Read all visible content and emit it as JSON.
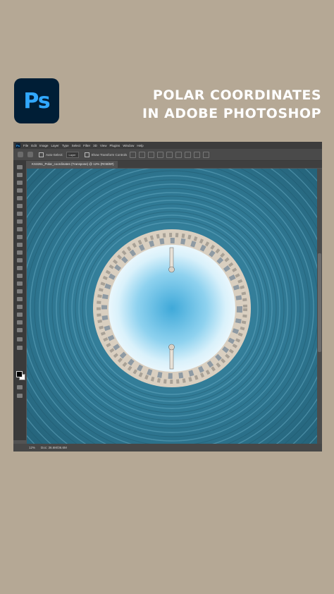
{
  "logo": {
    "text": "Ps"
  },
  "headline": {
    "line1": "POLAR COORDINATES",
    "line2": "IN ADOBE PHOTOSHOP"
  },
  "menubar": {
    "items": [
      "File",
      "Edit",
      "Image",
      "Layer",
      "Type",
      "Select",
      "Filter",
      "3D",
      "View",
      "Plugins",
      "Window",
      "Help"
    ]
  },
  "optionsbar": {
    "auto_select_label": "Auto-Select:",
    "auto_select_value": "Layer",
    "show_transform_label": "Show Transform Controls"
  },
  "document": {
    "tab_label": "KS3261_Polar_coordinates (Transpose) @ 12% (RGB/8#)",
    "zoom": "12%",
    "doc_info": "Doc: 36.6M/36.6M"
  },
  "colors": {
    "background": "#b5a895",
    "ps_blue": "#31a8ff",
    "ps_dark": "#001e36",
    "water": "#2a6f88",
    "sky": "#4fb8e0"
  }
}
